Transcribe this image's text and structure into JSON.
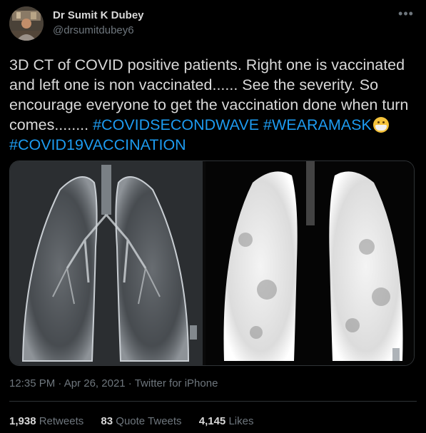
{
  "author": {
    "name": "Dr Sumit K Dubey",
    "handle": "@drsumitdubey6"
  },
  "tweet": {
    "text_plain": "3D CT of COVID positive patients. Right one is vaccinated and left one is non vaccinated...... See the severity. So encourage everyone to get the vaccination done when turn comes........ ",
    "hashtags": [
      "#COVIDSECONDWAVE",
      "#WEARAMASK",
      "#COVID19VACCINATION"
    ],
    "emoji_icon": "face-with-medical-mask-icon"
  },
  "meta": {
    "time": "12:35 PM",
    "date": "Apr 26, 2021",
    "source": "Twitter for iPhone",
    "separator": " · "
  },
  "stats": {
    "retweets_count": "1,938",
    "retweets_label": "Retweets",
    "quote_count": "83",
    "quote_label": "Quote Tweets",
    "likes_count": "4,145",
    "likes_label": "Likes"
  },
  "colors": {
    "background": "#000000",
    "text": "#d9d9d9",
    "muted": "#6e767d",
    "link": "#1d9bf0"
  }
}
